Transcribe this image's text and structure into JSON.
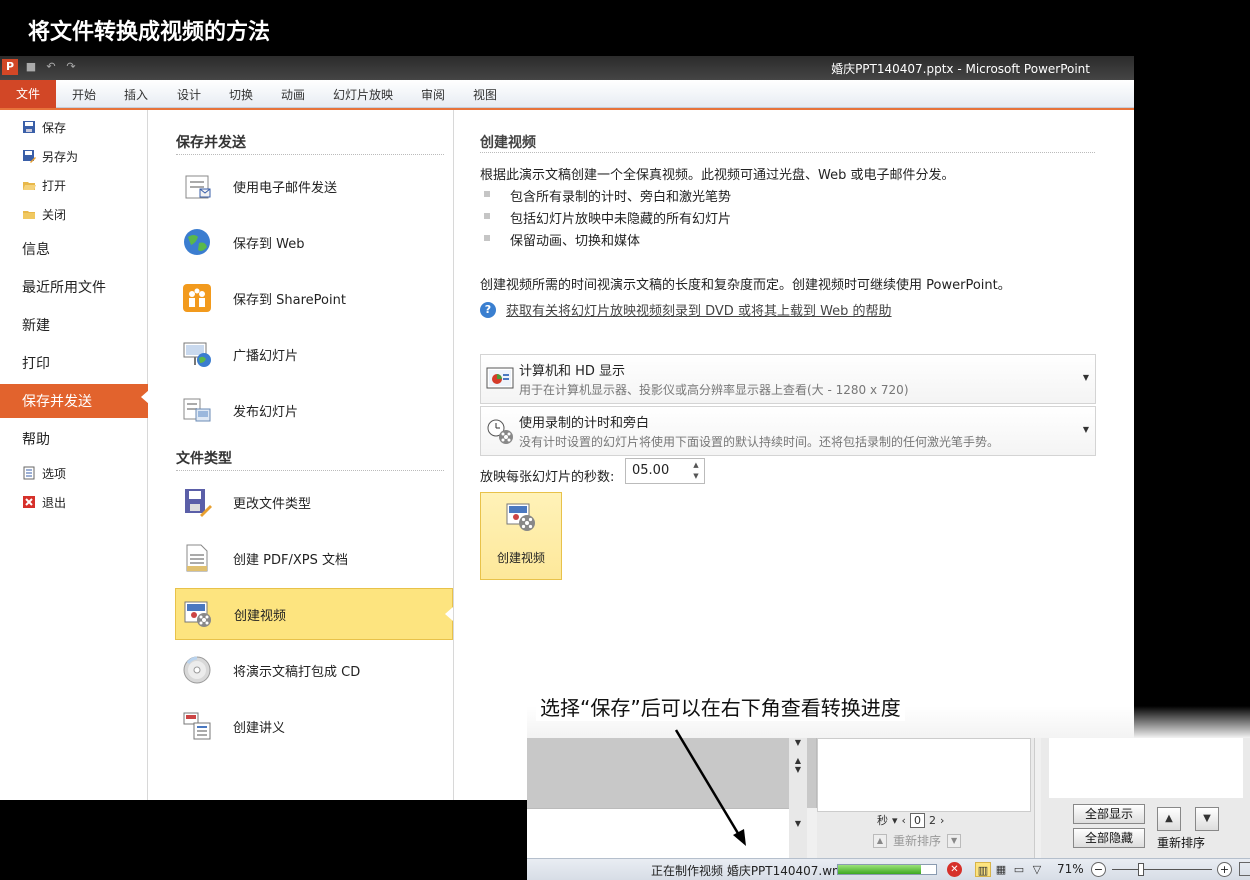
{
  "heading": "将文件转换成视频的方法",
  "window_title": "婚庆PPT140407.pptx  -  Microsoft PowerPoint",
  "ribbon_tabs": [
    "文件",
    "开始",
    "插入",
    "设计",
    "切换",
    "动画",
    "幻灯片放映",
    "审阅",
    "视图"
  ],
  "nav": {
    "items": [
      {
        "label": "保存",
        "icon": "save-icon"
      },
      {
        "label": "另存为",
        "icon": "save-as-icon"
      },
      {
        "label": "打开",
        "icon": "open-folder-icon"
      },
      {
        "label": "关闭",
        "icon": "close-folder-icon"
      },
      {
        "label": "信息"
      },
      {
        "label": "最近所用文件"
      },
      {
        "label": "新建"
      },
      {
        "label": "打印"
      },
      {
        "label": "保存并发送",
        "active": true
      },
      {
        "label": "帮助"
      },
      {
        "label": "选项",
        "icon": "options-icon"
      },
      {
        "label": "退出",
        "icon": "exit-icon"
      }
    ]
  },
  "middle": {
    "section1_title": "保存并发送",
    "section1_items": [
      {
        "label": "使用电子邮件发送",
        "icon": "email-icon"
      },
      {
        "label": "保存到 Web",
        "icon": "globe-icon"
      },
      {
        "label": "保存到 SharePoint",
        "icon": "sharepoint-icon"
      },
      {
        "label": "广播幻灯片",
        "icon": "broadcast-icon"
      },
      {
        "label": "发布幻灯片",
        "icon": "publish-icon"
      }
    ],
    "section2_title": "文件类型",
    "section2_items": [
      {
        "label": "更改文件类型",
        "icon": "change-file-type-icon"
      },
      {
        "label": "创建 PDF/XPS 文档",
        "icon": "pdf-document-icon"
      },
      {
        "label": "创建视频",
        "icon": "video-icon",
        "active": true
      },
      {
        "label": "将演示文稿打包成 CD",
        "icon": "cd-icon"
      },
      {
        "label": "创建讲义",
        "icon": "handout-icon"
      }
    ]
  },
  "content": {
    "title": "创建视频",
    "intro": "根据此演示文稿创建一个全保真视频。此视频可通过光盘、Web 或电子邮件分发。",
    "bullets": [
      "包含所有录制的计时、旁白和激光笔势",
      "包括幻灯片放映中未隐藏的所有幻灯片",
      "保留动画、切换和媒体"
    ],
    "note": "创建视频所需的时间视演示文稿的长度和复杂度而定。创建视频时可继续使用 PowerPoint。",
    "help_link": "获取有关将幻灯片放映视频刻录到 DVD 或将其上载到 Web 的帮助",
    "dropdown1": {
      "title": "计算机和 HD 显示",
      "desc": "用于在计算机显示器、投影仪或高分辨率显示器上查看(大 - 1280 x 720)"
    },
    "dropdown2": {
      "title": "使用录制的计时和旁白",
      "desc": "没有计时设置的幻灯片将使用下面设置的默认持续时间。还将包括录制的任何激光笔手势。"
    },
    "seconds_label": "放映每张幻灯片的秒数:",
    "seconds_value": "05.00",
    "create_button": "创建视频"
  },
  "annotation": "选择“保存”后可以在右下角查看转换进度",
  "inset": {
    "timing_unit": "秒",
    "timing_value1": "0",
    "timing_value2": "2",
    "reorder_disabled": "重新排序",
    "show_all": "全部显示",
    "hide_all": "全部隐藏",
    "reorder": "重新排序",
    "status_text": "正在制作视频 婚庆PPT140407.wmv",
    "progress": 0.85,
    "zoom": "71%"
  },
  "colors": {
    "file_tab": "#d24726",
    "active_nav": "#e2632d",
    "active_item": "#fde47f"
  }
}
